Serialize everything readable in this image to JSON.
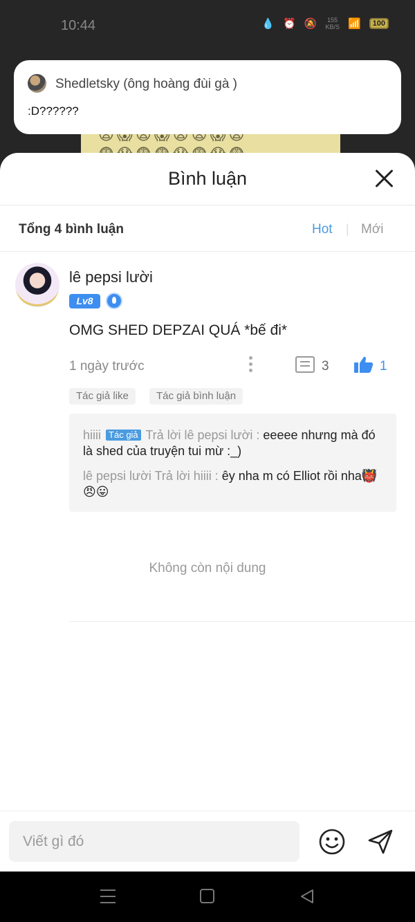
{
  "status_bar": {
    "time": "10:44",
    "net_speed_value": "155",
    "net_speed_unit": "KB/S",
    "battery": "100"
  },
  "notification": {
    "sender": "Shedletsky (ông hoàng đùi gà )",
    "message": ":D??????"
  },
  "sheet": {
    "title": "Bình luận",
    "total_label": "Tổng 4 bình luận",
    "sort_hot": "Hot",
    "sort_separator": "|",
    "sort_new": "Mới",
    "end_of_content": "Không còn nội dung"
  },
  "comment": {
    "author": "lê pepsi lười",
    "level": "Lv8",
    "text": "OMG SHED DEPZAI QUÁ *bế đi*",
    "time": "1 ngày trước",
    "reply_count": "3",
    "like_count": "1",
    "tags": [
      "Tác giả like",
      "Tác giả bình luận"
    ]
  },
  "replies": [
    {
      "author": "hiiii",
      "badge": "Tác giả",
      "prefix": "Trả lời lê pepsi lười :",
      "text": "eeeee nhưng mà đó là shed của truyện tui mừ :_)"
    },
    {
      "author": "lê pepsi lười",
      "prefix": "Trả lời hiiii :",
      "text": "êy nha m có Elliot rồi nha👹😠😛"
    }
  ],
  "input": {
    "placeholder": "Viết gì đó"
  },
  "colors": {
    "accent": "#4a9be0",
    "level_badge": "#3d8ef0",
    "text_primary": "#222222",
    "text_muted": "#999999"
  },
  "icons": [
    "close-icon",
    "more-icon",
    "reply-icon",
    "thumbs-up-icon",
    "emoji-icon",
    "send-icon",
    "nav-menu-icon",
    "nav-home-icon",
    "nav-back-icon"
  ]
}
